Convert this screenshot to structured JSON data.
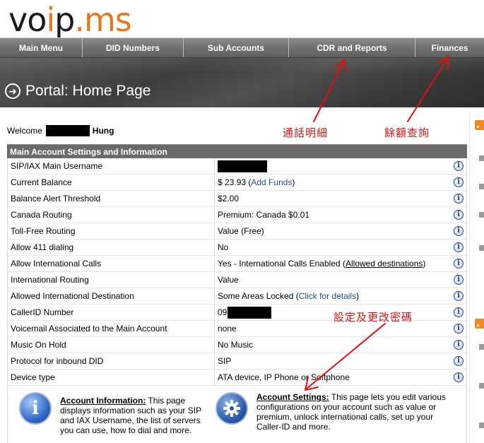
{
  "logo": {
    "main": "vo",
    "dot": "i",
    "rest": "p",
    "tld": ".ms"
  },
  "nav": [
    {
      "label": "Main Menu"
    },
    {
      "label": "DID Numbers"
    },
    {
      "label": "Sub Accounts"
    },
    {
      "label": "CDR and Reports"
    },
    {
      "label": "Finances"
    }
  ],
  "banner": {
    "title": "Portal: Home Page"
  },
  "welcome": {
    "prefix": "Welcome",
    "name": "Hung"
  },
  "table": {
    "header": "Main Account Settings and Information",
    "rows": [
      {
        "label": "SIP/IAX Main Username",
        "value": ""
      },
      {
        "label": "Current Balance",
        "value": "$ 23.93 (",
        "link": "Add Funds",
        "suffix": ")"
      },
      {
        "label": "Balance Alert Threshold",
        "value": "$2.00"
      },
      {
        "label": "Canada Routing",
        "value": "Premium: Canada $0.01"
      },
      {
        "label": "Toll-Free Routing",
        "value": "Value (Free)"
      },
      {
        "label": "Allow 411 dialing",
        "value": "No"
      },
      {
        "label": "Allow International Calls",
        "value": "Yes - International Calls Enabled (",
        "link": "Allowed destinations",
        "suffix": ")"
      },
      {
        "label": "International Routing",
        "value": "Value"
      },
      {
        "label": "Allowed International Destination",
        "value": "Some Areas Locked (",
        "link": "Click for details",
        "suffix": ")"
      },
      {
        "label": "CallerID Number",
        "value": "09"
      },
      {
        "label": "Voicemail Associated to the Main Account",
        "value": "none"
      },
      {
        "label": "Music On Hold",
        "value": "No Music"
      },
      {
        "label": "Protocol for inbound DID",
        "value": "SIP"
      },
      {
        "label": "Device type",
        "value": "ATA device, IP Phone or Softphone"
      }
    ]
  },
  "info_box": {
    "head": "Account Information:",
    "text": " This page displays information such as your SIP and IAX Username, the list of servers you can use, how to dial and more."
  },
  "settings_box": {
    "head": "Account Settings:",
    "text": " This page lets you edit various configurations on your account such as value or premium, unlock international calls, set up your Caller-ID and more."
  },
  "annotations": {
    "cdr": "通話明細",
    "finances": "餘額查詢",
    "settings": "設定及更改密碼"
  },
  "colors": {
    "annotation": "#e01010",
    "nav": "#707070",
    "link": "#1f4f9a",
    "brand": "#e8771c"
  }
}
